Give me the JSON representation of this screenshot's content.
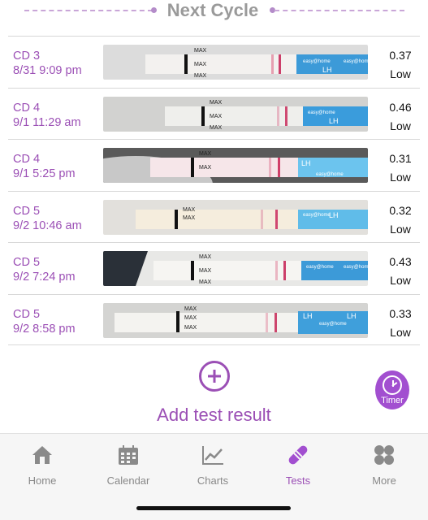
{
  "header": {
    "title": "Next Cycle"
  },
  "tests": [
    {
      "cd": "CD 3",
      "datetime": "8/31 9:09 pm",
      "value": "0.37",
      "result": "Low"
    },
    {
      "cd": "CD 4",
      "datetime": "9/1 11:29 am",
      "value": "0.46",
      "result": "Low"
    },
    {
      "cd": "CD 4",
      "datetime": "9/1 5:25 pm",
      "value": "0.31",
      "result": "Low"
    },
    {
      "cd": "CD 5",
      "datetime": "9/2 10:46 am",
      "value": "0.32",
      "result": "Low"
    },
    {
      "cd": "CD 5",
      "datetime": "9/2 7:24 pm",
      "value": "0.43",
      "result": "Low"
    },
    {
      "cd": "CD 5",
      "datetime": "9/2 8:58 pm",
      "value": "0.33",
      "result": "Low"
    }
  ],
  "add": {
    "label": "Add test result"
  },
  "timer": {
    "label": "Timer"
  },
  "strip_text": {
    "max": "MAX",
    "lh": "LH",
    "brand": "easy@home"
  },
  "tabs": [
    {
      "label": "Home",
      "icon": "house-icon"
    },
    {
      "label": "Calendar",
      "icon": "calendar-icon"
    },
    {
      "label": "Charts",
      "icon": "line-chart-icon"
    },
    {
      "label": "Tests",
      "icon": "test-strip-icon",
      "active": true
    },
    {
      "label": "More",
      "icon": "grid-icon"
    }
  ],
  "colors": {
    "accent": "#9b4fb5",
    "timer": "#a24fd0",
    "inactive": "#888888"
  }
}
